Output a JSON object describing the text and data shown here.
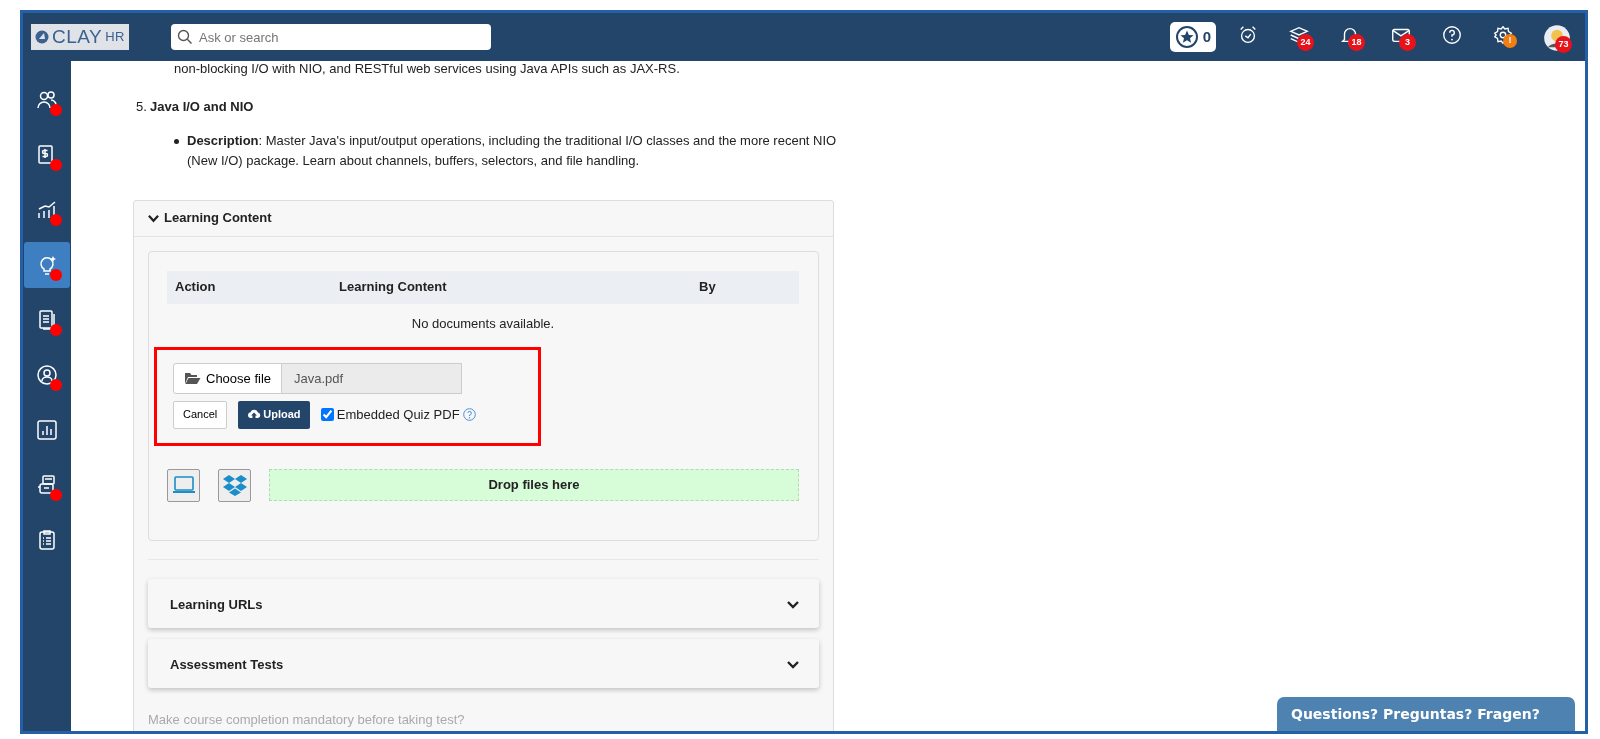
{
  "header": {
    "logo": "CLAY",
    "logo_suffix": "HR",
    "search": {
      "placeholder": "Ask or search"
    },
    "points": "0",
    "icons": [
      {
        "kind": "alarm"
      },
      {
        "kind": "layers",
        "badge": "24"
      },
      {
        "kind": "bell",
        "badge": "18"
      },
      {
        "kind": "mail",
        "badge": "3"
      },
      {
        "kind": "help"
      },
      {
        "kind": "settings",
        "warning": "!"
      },
      {
        "kind": "avatar",
        "badge": "73"
      }
    ]
  },
  "sidebar": {
    "items": [
      {
        "kind": "people",
        "alert": true,
        "selected": false
      },
      {
        "kind": "money",
        "alert": true,
        "selected": false
      },
      {
        "kind": "growth",
        "alert": true,
        "selected": false
      },
      {
        "kind": "bulb",
        "alert": true,
        "selected": true
      },
      {
        "kind": "document",
        "alert": true,
        "selected": false
      },
      {
        "kind": "profile",
        "alert": true,
        "selected": false
      },
      {
        "kind": "report",
        "alert": false,
        "selected": false
      },
      {
        "kind": "robot",
        "alert": true,
        "selected": false
      },
      {
        "kind": "checklist",
        "alert": false,
        "selected": false
      }
    ]
  },
  "article": {
    "intro": "non-blocking I/O with NIO, and RESTful web services using Java APIs such as JAX-RS.",
    "item_number": "5.",
    "item_title": "Java I/O and NIO",
    "description": "**Description**: Master Java's input/output operations, including the traditional I/O classes and the more recent NIO (New I/O) package. Learn about channels, buffers, selectors, and file handling."
  },
  "learning_content": {
    "title": "Learning Content",
    "expanded": true,
    "table": {
      "columns": [
        "Action",
        "Learning Content",
        "By"
      ],
      "empty_message": "No documents available."
    },
    "upload": {
      "choose_label": "Choose file",
      "file_name": "Java.pdf",
      "cancel": "Cancel",
      "upload": "Upload",
      "embedded_quiz_label": "Embedded Quiz PDF",
      "embedded_quiz_checked": true
    },
    "drop_zone": "Drop files here"
  },
  "sections": [
    {
      "title": "Learning URLs",
      "expanded": false
    },
    {
      "title": "Assessment Tests",
      "expanded": false
    }
  ],
  "footer_question": "Make course completion mandatory before taking test?",
  "help_widget": "Questions? Preguntas? Fragen?"
}
